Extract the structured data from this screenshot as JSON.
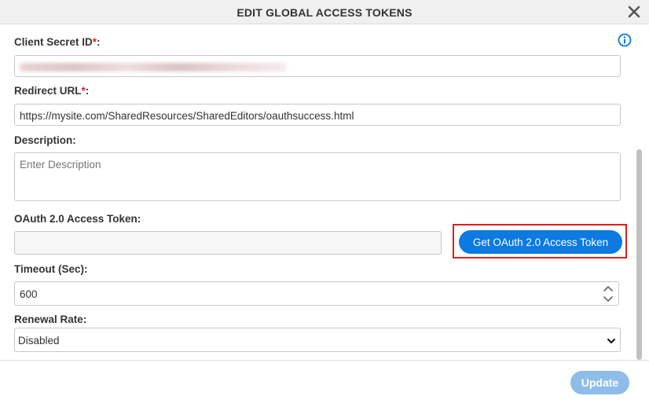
{
  "dialog": {
    "title": "EDIT GLOBAL ACCESS TOKENS",
    "close_icon": "close-icon",
    "info_icon": "info-icon"
  },
  "fields": {
    "client_secret": {
      "label": "Client Secret ID",
      "required_mark": "*",
      "suffix": ":"
    },
    "redirect_url": {
      "label": "Redirect URL",
      "required_mark": "*",
      "suffix": ":",
      "value": "https://mysite.com/SharedResources/SharedEditors/oauthsuccess.html"
    },
    "description": {
      "label": "Description:",
      "placeholder": "Enter Description"
    },
    "oauth_token": {
      "label": "OAuth 2.0 Access Token:",
      "button_label": "Get OAuth 2.0 Access Token"
    },
    "timeout": {
      "label": "Timeout (Sec):",
      "value": "600"
    },
    "renewal_rate": {
      "label": "Renewal Rate:",
      "value": "Disabled"
    }
  },
  "footer": {
    "update_label": "Update"
  },
  "colors": {
    "primary": "#0c7ae0",
    "required": "#e0201b",
    "highlight_frame": "#e01e1e",
    "update_disabled": "#8fbde9"
  }
}
